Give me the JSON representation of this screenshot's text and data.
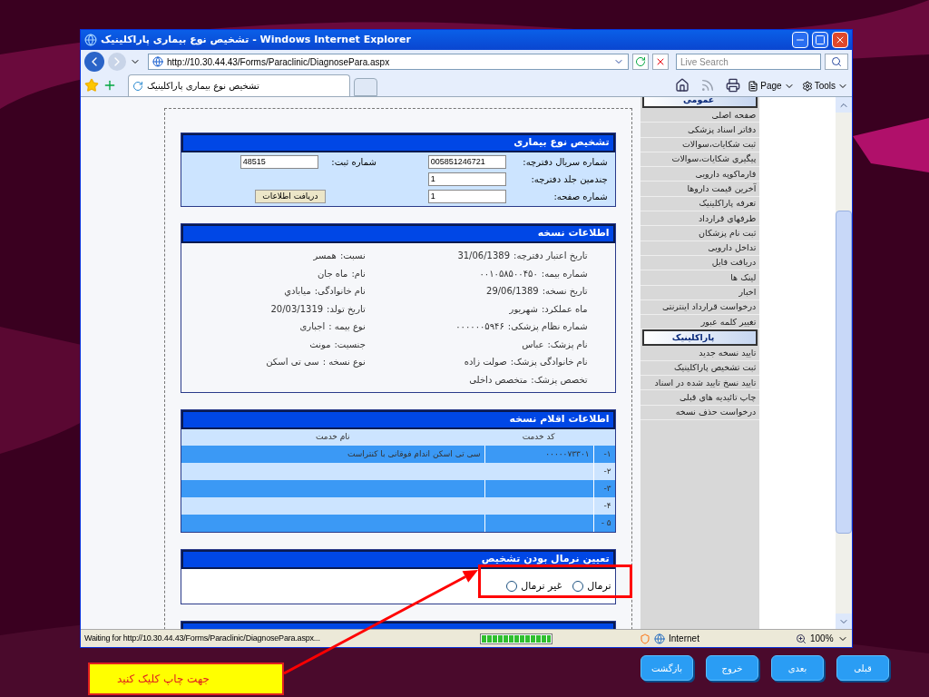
{
  "window": {
    "title": "تشخیص نوع بیماری پاراکلینیک - Windows Internet Explorer"
  },
  "address_bar": {
    "url": "http://10.30.44.43/Forms/Paraclinic/DiagnosePara.aspx"
  },
  "search": {
    "placeholder": "Live Search"
  },
  "tab": {
    "label": "تشخیص نوع بیماری پاراکلینیک"
  },
  "page_menu": {
    "label": "Page"
  },
  "tools_menu": {
    "label": "Tools"
  },
  "sidebar": {
    "sections": [
      {
        "title": "عمومی",
        "items": [
          "صفحه اصلی",
          "دفاتر اسناد پزشکی",
          "ثبت شکایات،سوالات",
          "پیگیری شکایات،سوالات",
          "فارماکوپه دارویی",
          "آخرین قیمت داروها",
          "تعرفه پاراکلینیک",
          "طرفهای قرارداد",
          "ثبت نام پزشکان",
          "تداخل دارویی",
          "دریافت فایل",
          "لینک ها",
          "اخبار",
          "درخواست قرارداد اینترنتی",
          "تغییر کلمه عبور"
        ]
      },
      {
        "title": "پاراکلینیک",
        "items": [
          "تایید نسخه جدید",
          "ثبت تشخیص پاراکلینیک",
          "تایید نسخ تایید شده در اسناد",
          "چاپ تائیدیه های قبلی",
          "درخواست حذف نسخه"
        ]
      }
    ]
  },
  "diagnosis_panel": {
    "title": "تشخیص نوع بیماری",
    "fields": [
      {
        "label": "شماره سریال دفترچه:",
        "value": "005851246721"
      },
      {
        "label": "چندمین جلد دفترچه:",
        "value": "1"
      },
      {
        "label": "شماره صفحه:",
        "value": "1"
      }
    ],
    "registration": {
      "label": "شماره ثبت:",
      "value": "48515"
    },
    "button": "دریافت اطلاعات"
  },
  "prescription_panel": {
    "title": "اطلاعات نسخه",
    "right": [
      {
        "label": "تاریخ اعتبار دفترچه:",
        "value": "31/06/1389"
      },
      {
        "label": "شماره بیمه:",
        "value": "۰۰۱۰۵۸۵۰۰۴۵۰"
      },
      {
        "label": "تاریخ نسخه:",
        "value": "29/06/1389"
      },
      {
        "label": "ماه عملکرد:",
        "value": "شهریور"
      },
      {
        "label": "شماره نظام پزشکی:",
        "value": "۰۰۰۰۰۰۵۹۴۶"
      },
      {
        "label": "نام پزشک:",
        "value": "عباس"
      },
      {
        "label": "نام خانوادگی پزشک:",
        "value": "صولت زاده"
      },
      {
        "label": "تخصص پزشک:",
        "value": "متخصص داخلی"
      }
    ],
    "left": [
      {
        "label": "نسبت:",
        "value": "همسر"
      },
      {
        "label": "نام:",
        "value": "ماه جان"
      },
      {
        "label": "نام خانوادگی:",
        "value": "میابادي"
      },
      {
        "label": "تاریخ تولد:",
        "value": "20/03/1319"
      },
      {
        "label": "نوع بیمه :",
        "value": "اجباری"
      },
      {
        "label": "جنسیت:",
        "value": "مونث"
      },
      {
        "label": "نوع نسخه :",
        "value": "سی تی اسکن"
      }
    ]
  },
  "items_panel": {
    "title": "اطلاعات اقلام نسخه",
    "columns": [
      "کد خدمت",
      "نام خدمت"
    ],
    "rows": [
      {
        "index": "۱-",
        "code": "۰۰۰۰۰۷۳۳۰۱",
        "name": "سی تی اسکن اندام فوقانی با کنتراست"
      },
      {
        "index": "۲-"
      },
      {
        "index": "۳-"
      },
      {
        "index": "۴-"
      },
      {
        "index": "۵ -"
      }
    ]
  },
  "normality_panel": {
    "title": "تعیین نرمال بودن تشخیص",
    "options": [
      {
        "label": "نرمال",
        "selected": false
      },
      {
        "label": "غیر نرمال",
        "selected": false
      }
    ]
  },
  "status_bar": {
    "text": "Waiting for http://10.30.44.43/Forms/Paraclinic/DiagnosePara.aspx...",
    "progress": {
      "level": 1
    },
    "zone": "Internet",
    "zoom": "100%"
  },
  "callout": {
    "text": "جهت چاپ کلیک کنید"
  },
  "nav_buttons": [
    "قبلی",
    "بعدی",
    "خروج",
    "بازگشت"
  ]
}
